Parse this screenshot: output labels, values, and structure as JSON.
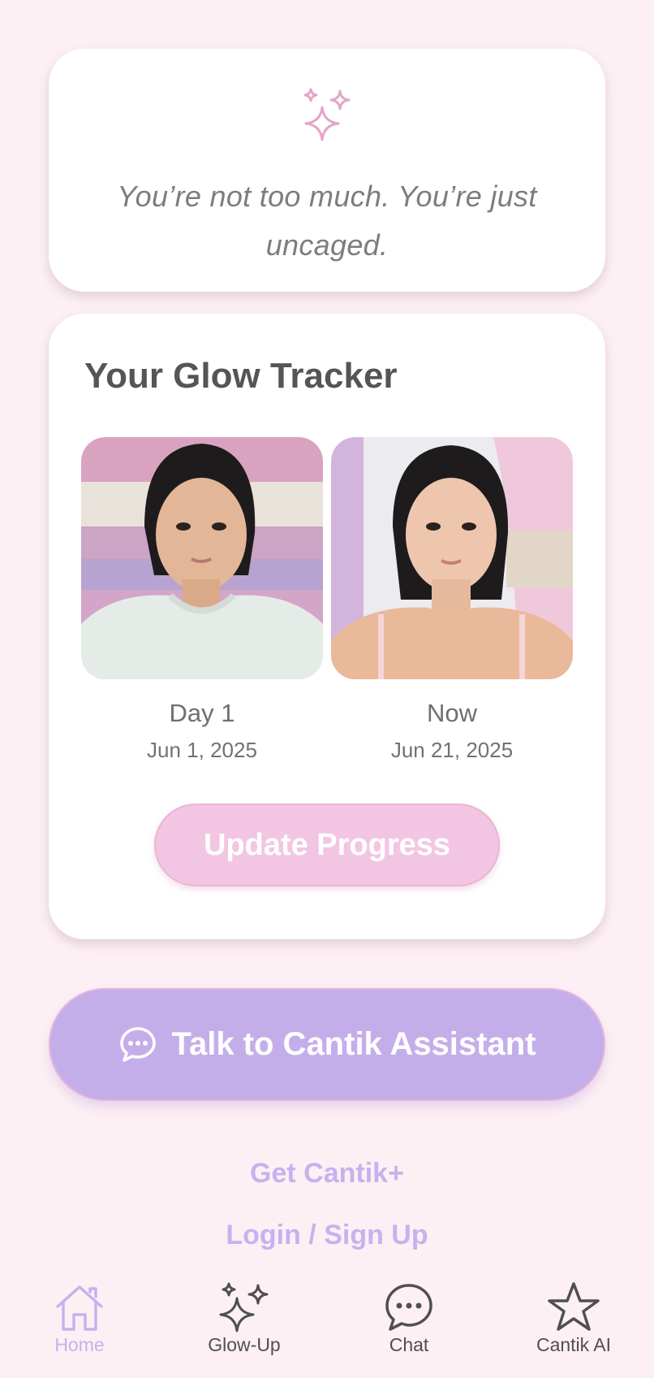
{
  "quote": {
    "text": "You’re not too much. You’re just uncaged.",
    "icon": "sparkles-icon"
  },
  "tracker": {
    "title": "Your Glow Tracker",
    "photos": [
      {
        "label": "Day 1",
        "date": "Jun 1, 2025"
      },
      {
        "label": "Now",
        "date": "Jun 21, 2025"
      }
    ],
    "update_button": "Update Progress"
  },
  "assistant_button": {
    "label": "Talk to Cantik Assistant",
    "icon": "chat-bubble-icon"
  },
  "links": {
    "plus": "Get Cantik+",
    "login": "Login / Sign Up"
  },
  "tabbar": {
    "tabs": [
      {
        "label": "Home",
        "icon": "home-icon",
        "active": true
      },
      {
        "label": "Glow-Up",
        "icon": "sparkles-icon",
        "active": false
      },
      {
        "label": "Chat",
        "icon": "chat-bubble-icon",
        "active": false
      },
      {
        "label": "Cantik AI",
        "icon": "star-icon",
        "active": false
      }
    ]
  },
  "colors": {
    "background": "#fdf0f4",
    "accent_lavender": "#c4aeea",
    "accent_pink": "#f2c6e3",
    "link_lavender": "#c8b1ee",
    "sparkle_pink": "#e3a6c8"
  }
}
